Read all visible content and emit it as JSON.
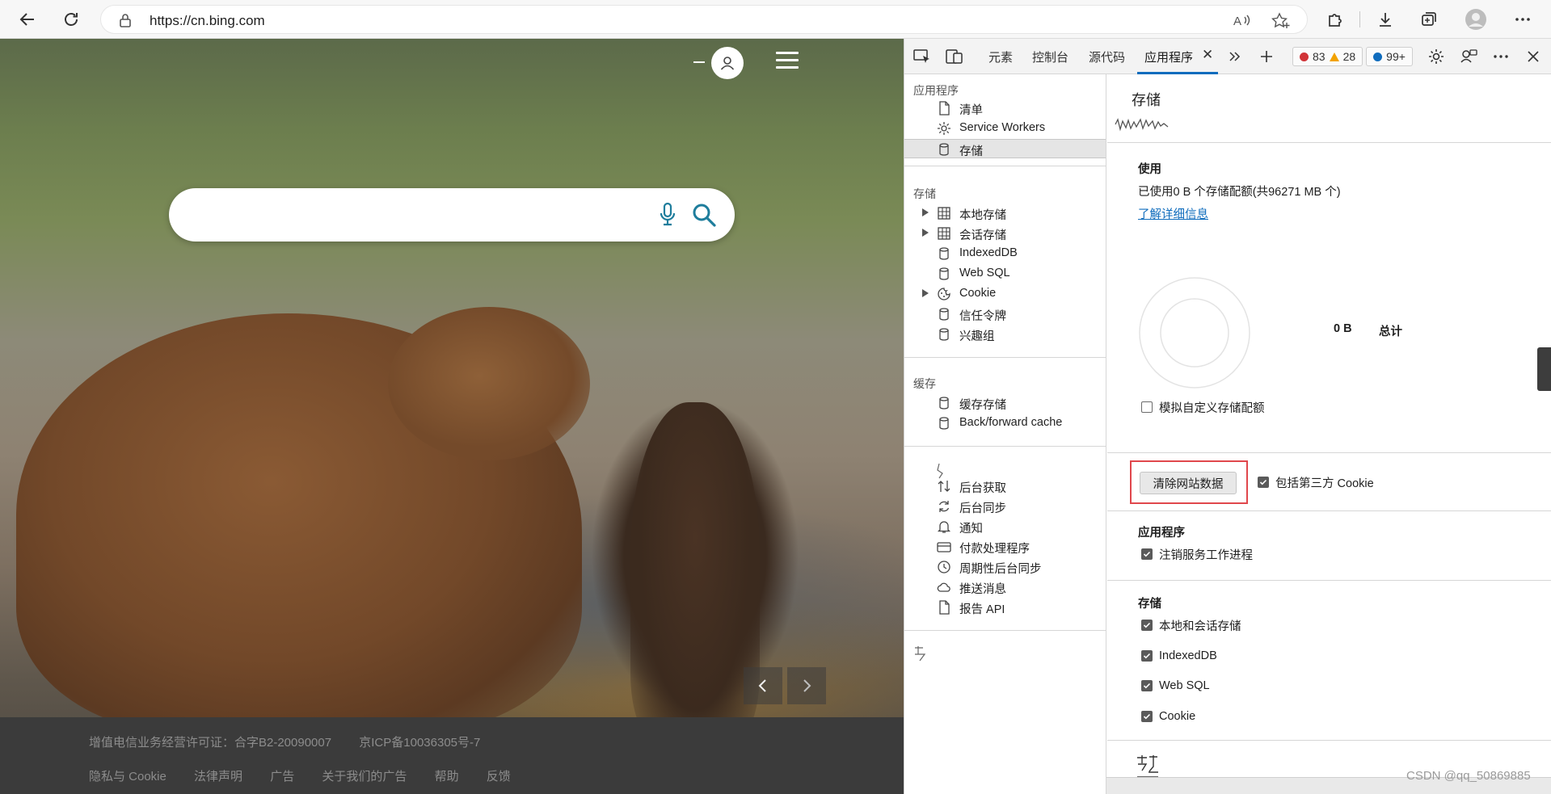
{
  "browser": {
    "url": "https://cn.bing.com"
  },
  "page": {
    "search_placeholder": "",
    "footer": {
      "license": "增值电信业务经营许可证：合字B2-20090007",
      "icp": "京ICP备10036305号-7",
      "links": [
        "隐私与 Cookie",
        "法律声明",
        "广告",
        "关于我们的广告",
        "帮助",
        "反馈"
      ]
    }
  },
  "devtools": {
    "tabs": [
      "元素",
      "控制台",
      "源代码",
      "应用程序"
    ],
    "active_tab": "应用程序",
    "badges": {
      "errors": "83",
      "warnings": "28",
      "messages": "99+",
      "error_color": "#d13438",
      "warning_color": "#f2a200",
      "message_color": "#0f6cbd"
    },
    "sidebar": {
      "app_heading": "应用程序",
      "app_items": [
        "清单",
        "Service Workers",
        "存储"
      ],
      "storage_heading": "存储",
      "storage_items": [
        "本地存储",
        "会话存储",
        "IndexedDB",
        "Web SQL",
        "Cookie",
        "信任令牌",
        "兴趣组"
      ],
      "cache_heading": "缓存",
      "cache_items": [
        "缓存存储",
        "Back/forward cache"
      ],
      "bg_items": [
        "后台获取",
        "后台同步",
        "通知",
        "付款处理程序",
        "周期性后台同步",
        "推送消息",
        "报告 API"
      ]
    },
    "main": {
      "title": "存储",
      "usage_heading": "使用",
      "usage_text": "已使用0 B 个存储配额(共96271 MB 个)",
      "learn_more": "了解详细信息",
      "total_value": "0 B",
      "total_label": "总计",
      "simulate_quota": "模拟自定义存储配额",
      "clear_button": "清除网站数据",
      "include_third_party": "包括第三方 Cookie",
      "app_heading": "应用程序",
      "unregister_sw": "注销服务工作进程",
      "storage_heading": "存储",
      "storage_options": [
        "本地和会话存储",
        "IndexedDB",
        "Web SQL",
        "Cookie"
      ]
    }
  },
  "watermark": "CSDN @qq_50869885"
}
